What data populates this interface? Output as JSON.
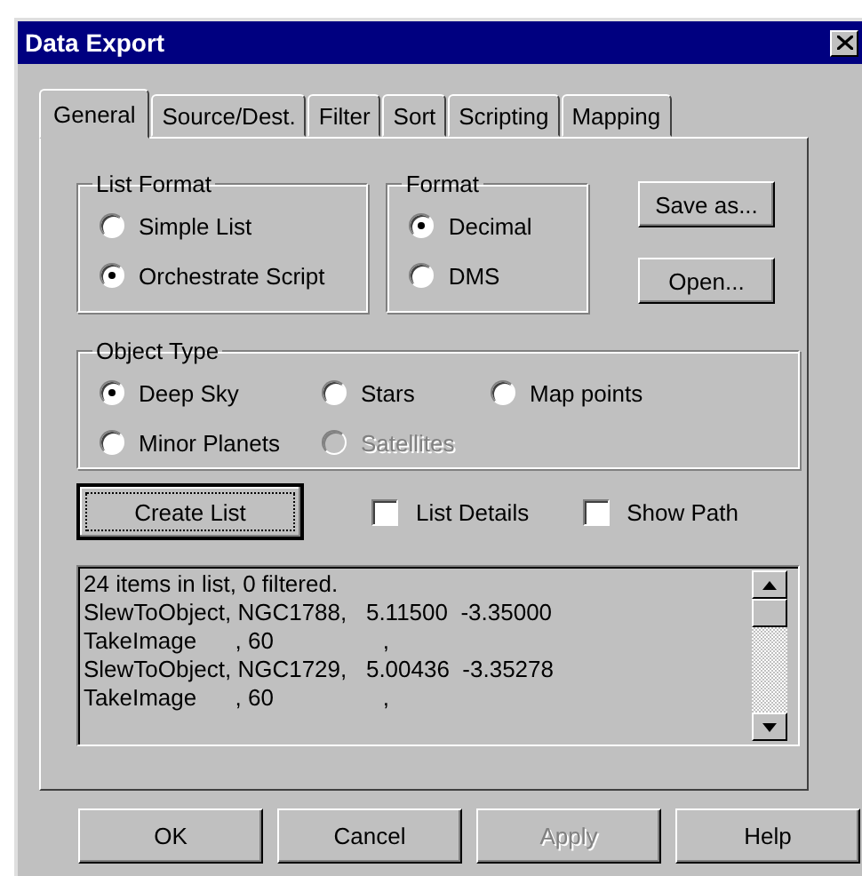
{
  "window": {
    "title": "Data Export"
  },
  "tabs": [
    {
      "label": "General",
      "selected": true
    },
    {
      "label": "Source/Dest.",
      "selected": false
    },
    {
      "label": "Filter",
      "selected": false
    },
    {
      "label": "Sort",
      "selected": false
    },
    {
      "label": "Scripting",
      "selected": false
    },
    {
      "label": "Mapping",
      "selected": false
    }
  ],
  "list_format": {
    "title": "List Format",
    "options": [
      {
        "label": "Simple List",
        "selected": false
      },
      {
        "label": "Orchestrate Script",
        "selected": true
      }
    ]
  },
  "format": {
    "title": "Format",
    "options": [
      {
        "label": "Decimal",
        "selected": true
      },
      {
        "label": "DMS",
        "selected": false
      }
    ]
  },
  "side_buttons": [
    "Save as...",
    "Open..."
  ],
  "object_type": {
    "title": "Object Type",
    "options": [
      {
        "label": "Deep Sky",
        "selected": true,
        "disabled": false
      },
      {
        "label": "Stars",
        "selected": false,
        "disabled": false
      },
      {
        "label": "Map points",
        "selected": false,
        "disabled": false
      },
      {
        "label": "Minor Planets",
        "selected": false,
        "disabled": false
      },
      {
        "label": "Satellites",
        "selected": false,
        "disabled": true
      }
    ]
  },
  "create_button": "Create List",
  "checkboxes": [
    {
      "label": "List Details",
      "checked": false
    },
    {
      "label": "Show Path",
      "checked": false
    }
  ],
  "output_lines": [
    "24 items in list, 0 filtered.",
    "SlewToObject, NGC1788,   5.11500  -3.35000",
    "TakeImage      , 60                 ,",
    "SlewToObject, NGC1729,   5.00436  -3.35278",
    "TakeImage      , 60                 ,"
  ],
  "buttons": [
    {
      "label": "OK",
      "disabled": false
    },
    {
      "label": "Cancel",
      "disabled": false
    },
    {
      "label": "Apply",
      "disabled": true
    },
    {
      "label": "Help",
      "disabled": false
    }
  ]
}
